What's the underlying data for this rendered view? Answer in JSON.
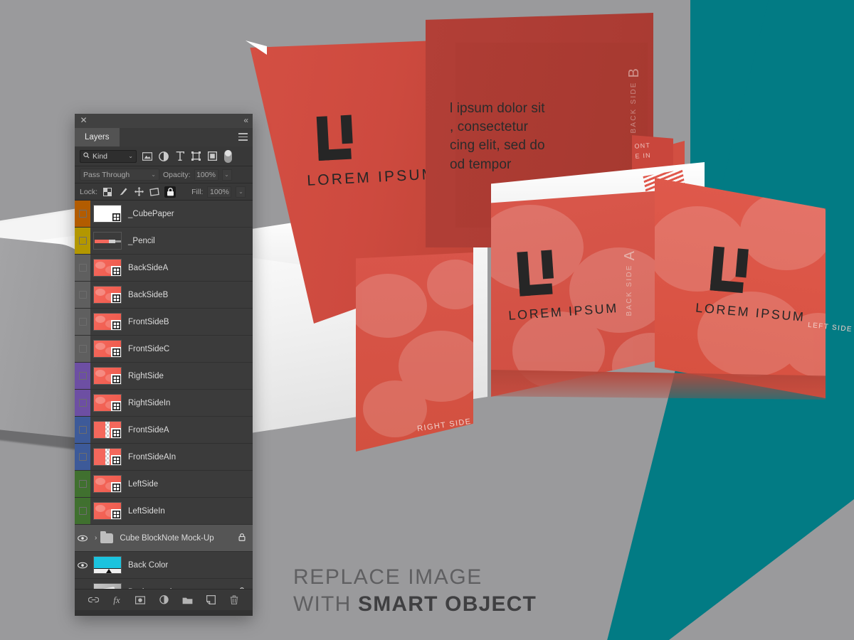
{
  "canvas": {
    "colors": {
      "background_gray": "#9a9a9c",
      "teal": "#027b84",
      "red_bright": "#dd5044",
      "red_dark": "#a33630",
      "ink": "#262626"
    }
  },
  "artwork": {
    "logo_word": "LOREM IPSUM",
    "body_copy": "m ipsum dolor sit\nt, consectetur\nadipiscing elit, sed do\neiusmod tempor",
    "body_copy_lines": [
      "l ipsum dolor sit",
      ", consectetur",
      "cing elit, sed do",
      "od tempor"
    ],
    "labels": {
      "back_side_b": "BACK SIDE",
      "back_side_b_letter": "B",
      "back_side_a": "BACK SIDE",
      "back_side_a_letter": "A",
      "left_side": "LEFT SIDE",
      "right_side": "RIGHT SIDE",
      "front_side_in": "FRONT\nSIDE IN",
      "front_side_in_lines": [
        "ONT",
        "E IN"
      ]
    }
  },
  "caption": {
    "line1": "REPLACE IMAGE",
    "line2_prefix": "WITH ",
    "line2_bold": "SMART OBJECT"
  },
  "panel": {
    "title": "Layers",
    "close_icon": "✕",
    "collapse_icon": "«",
    "menu_icon": "hamburger-icon",
    "filter": {
      "kind_label": "Kind",
      "search_icon": "🔍",
      "chevron": "⌄",
      "icons": [
        {
          "name": "pixel-layer-filter-icon"
        },
        {
          "name": "adjustment-layer-filter-icon"
        },
        {
          "name": "type-layer-filter-icon"
        },
        {
          "name": "shape-layer-filter-icon"
        },
        {
          "name": "smart-object-filter-icon"
        }
      ],
      "toggle_name": "filter-enable-toggle"
    },
    "blend": {
      "mode": "Pass Through",
      "opacity_label": "Opacity:",
      "opacity_value": "100%",
      "chevron": "⌄"
    },
    "lock": {
      "label": "Lock:",
      "fill_label": "Fill:",
      "fill_value": "100%",
      "items": [
        {
          "name": "lock-transparent-pixels-icon",
          "active": false
        },
        {
          "name": "lock-image-pixels-icon",
          "active": false
        },
        {
          "name": "lock-position-icon",
          "active": false
        },
        {
          "name": "lock-artboard-nesting-icon",
          "active": false
        },
        {
          "name": "lock-all-icon",
          "active": true
        }
      ]
    },
    "layers": [
      {
        "name": "_CubePaper",
        "color": "#b35c00",
        "thumb": "white",
        "smart": true,
        "visible": false,
        "locked": false,
        "selected": false
      },
      {
        "name": "_Pencil",
        "color": "#b39700",
        "thumb": "pencil",
        "smart": false,
        "visible": false,
        "locked": false,
        "selected": false
      },
      {
        "name": "BackSideA",
        "color": "#5f5f5f",
        "thumb": "red",
        "smart": true,
        "visible": false,
        "locked": false,
        "selected": false
      },
      {
        "name": "BackSideB",
        "color": "#5f5f5f",
        "thumb": "red",
        "smart": true,
        "visible": false,
        "locked": false,
        "selected": false
      },
      {
        "name": "FrontSideB",
        "color": "#5f5f5f",
        "thumb": "red",
        "smart": true,
        "visible": false,
        "locked": false,
        "selected": false
      },
      {
        "name": "FrontSideC",
        "color": "#5f5f5f",
        "thumb": "red",
        "smart": true,
        "visible": false,
        "locked": false,
        "selected": false
      },
      {
        "name": "RightSide",
        "color": "#6d4fa3",
        "thumb": "red",
        "smart": true,
        "visible": false,
        "locked": false,
        "selected": false
      },
      {
        "name": "RightSideIn",
        "color": "#6d4fa3",
        "thumb": "red",
        "smart": true,
        "visible": false,
        "locked": false,
        "selected": false
      },
      {
        "name": "FrontSideA",
        "color": "#3d5a99",
        "thumb": "checker",
        "smart": true,
        "visible": false,
        "locked": false,
        "selected": false
      },
      {
        "name": "FrontSideAIn",
        "color": "#3d5a99",
        "thumb": "checker",
        "smart": true,
        "visible": false,
        "locked": false,
        "selected": false
      },
      {
        "name": "LeftSide",
        "color": "#40702f",
        "thumb": "red",
        "smart": true,
        "visible": false,
        "locked": false,
        "selected": false
      },
      {
        "name": "LeftSideIn",
        "color": "#40702f",
        "thumb": "red",
        "smart": true,
        "visible": false,
        "locked": false,
        "selected": false
      },
      {
        "name": "Cube BlockNote Mock-Up",
        "color": "none",
        "thumb": "folder",
        "smart": false,
        "visible": true,
        "locked": true,
        "selected": true
      },
      {
        "name": "Back Color",
        "color": "none",
        "thumb": "cyan",
        "smart": false,
        "visible": true,
        "locked": false,
        "selected": false
      },
      {
        "name": "Background",
        "color": "none",
        "thumb": "gray",
        "smart": false,
        "visible": true,
        "locked": true,
        "selected": false
      }
    ],
    "bottom_icons": [
      {
        "name": "link-layers-icon",
        "glyph": "⚭"
      },
      {
        "name": "layer-style-fx-icon",
        "glyph": "fx"
      },
      {
        "name": "add-layer-mask-icon",
        "glyph": "▣"
      },
      {
        "name": "new-adjustment-layer-icon",
        "glyph": "◐"
      },
      {
        "name": "new-group-icon",
        "glyph": "▬"
      },
      {
        "name": "new-layer-icon",
        "glyph": "⧉"
      },
      {
        "name": "delete-layer-icon",
        "glyph": ""
      }
    ]
  }
}
